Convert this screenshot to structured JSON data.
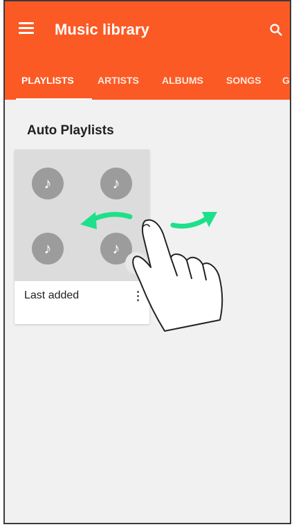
{
  "app": {
    "title": "Music library"
  },
  "tabs": [
    {
      "label": "PLAYLISTS",
      "active": true
    },
    {
      "label": "ARTISTS",
      "active": false
    },
    {
      "label": "ALBUMS",
      "active": false
    },
    {
      "label": "SONGS",
      "active": false
    },
    {
      "label": "GE",
      "active": false
    }
  ],
  "section": {
    "title": "Auto Playlists"
  },
  "playlists": [
    {
      "name": "Last added"
    }
  ],
  "colors": {
    "appbar": "#fb5a24",
    "arrow": "#1ee08a",
    "note_circle": "#9c9c9c"
  },
  "icons": {
    "menu": "hamburger-menu-icon",
    "search": "search-icon",
    "note": "music-note-icon",
    "play": "play-icon",
    "more": "more-vertical-icon"
  }
}
